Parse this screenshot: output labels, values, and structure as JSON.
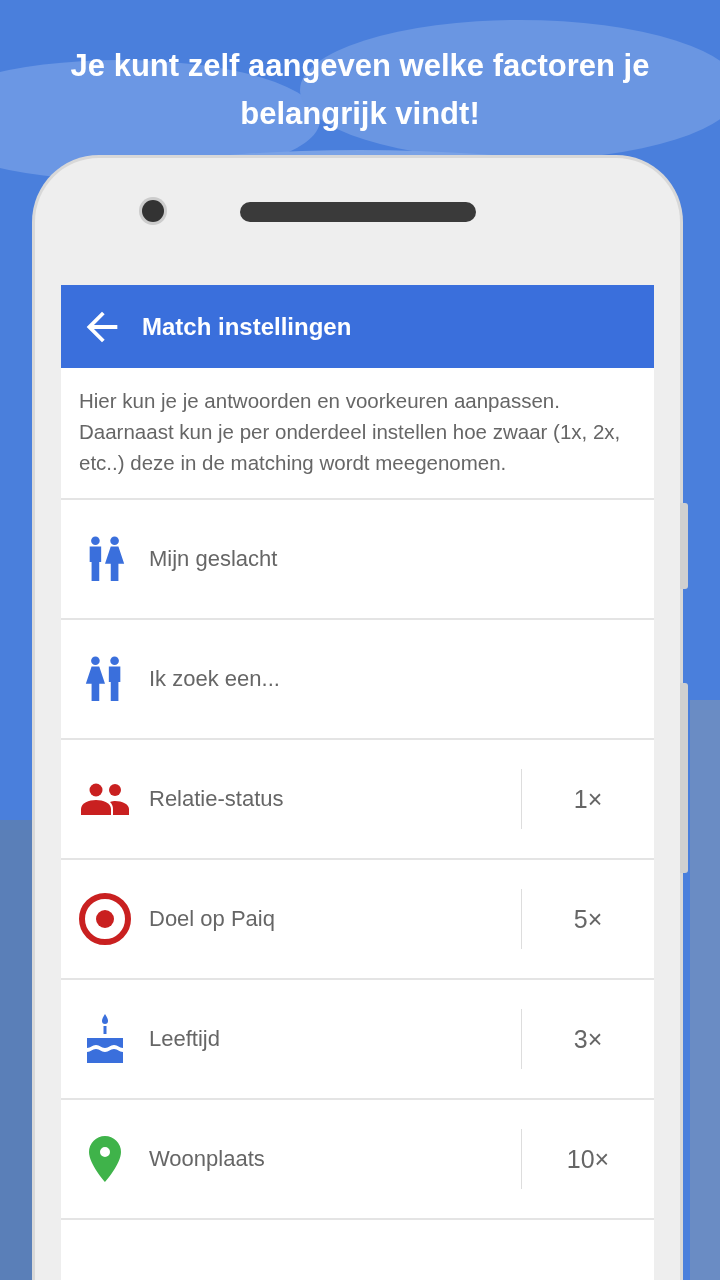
{
  "headline": "Je kunt zelf aangeven welke factoren je belangrijk vindt!",
  "app_bar": {
    "title": "Match instellingen"
  },
  "description": "Hier kun je je antwoorden en voorkeuren aanpassen. Daarnaast kun je per onderdeel instellen hoe zwaar (1x, 2x, etc..) deze in de matching wordt meegenomen.",
  "items": [
    {
      "kind": "gender",
      "label": "Mijn geslacht"
    },
    {
      "kind": "seeking",
      "label": "Ik zoek een..."
    },
    {
      "kind": "relationship",
      "label": "Relatie-status",
      "weight": "1×"
    },
    {
      "kind": "goal",
      "label": "Doel op Paiq",
      "weight": "5×"
    },
    {
      "kind": "age",
      "label": "Leeftijd",
      "weight": "3×"
    },
    {
      "kind": "location",
      "label": "Woonplaats",
      "weight": "10×"
    }
  ]
}
